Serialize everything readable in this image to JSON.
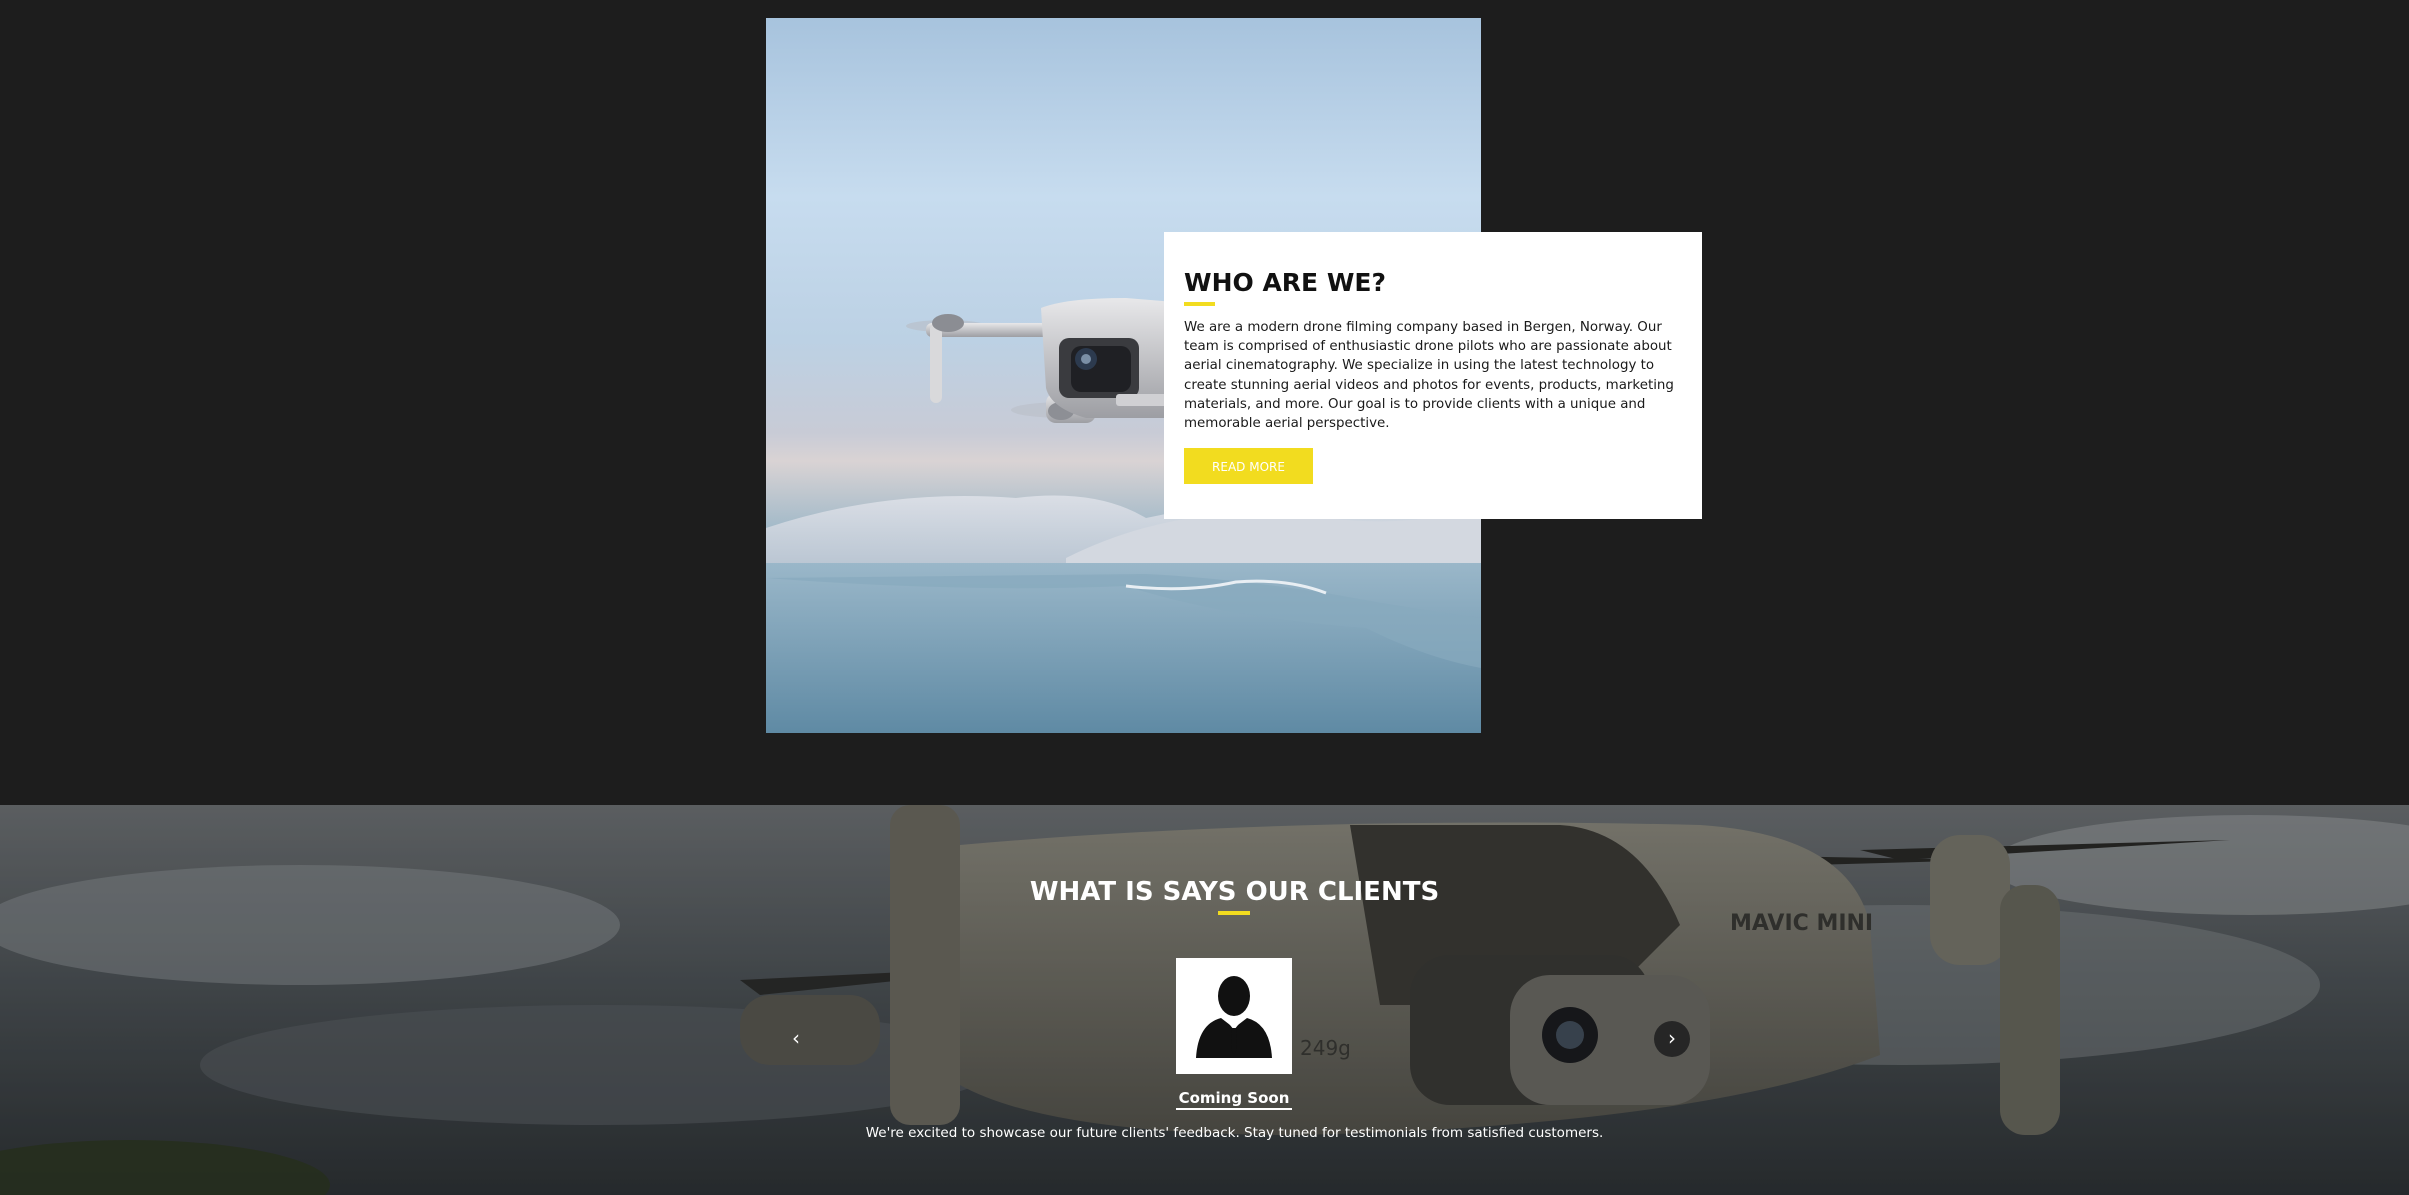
{
  "about": {
    "title": "WHO ARE WE?",
    "text": "We are a modern drone filming company based in Bergen, Norway. Our team is comprised of enthusiastic drone pilots who are passionate about aerial cinematography. We specialize in using the latest technology to create stunning aerial videos and photos for events, products, marketing materials, and more. Our goal is to provide clients with a unique and memorable aerial perspective.",
    "button_label": "READ MORE",
    "image": "drone-over-water-photo"
  },
  "clients": {
    "title": "WHAT IS SAYS OUR CLIENTS",
    "background_image": "mavic-mini-drone-photo",
    "drone_brand_text": "MAVIC MINI",
    "drone_weight_text": "249g",
    "prev_icon": "chevron-left-icon",
    "next_icon": "chevron-right-icon",
    "prev_symbol": "‹",
    "next_symbol": "›",
    "testimonial": {
      "avatar": "person-silhouette-icon",
      "name": "Coming Soon",
      "text": "We're excited to showcase our future clients' feedback. Stay tuned for testimonials from satisfied customers."
    }
  },
  "colors": {
    "accent": "#f2dc1f",
    "page_bg": "#1d1d1d",
    "card_bg": "#ffffff"
  }
}
